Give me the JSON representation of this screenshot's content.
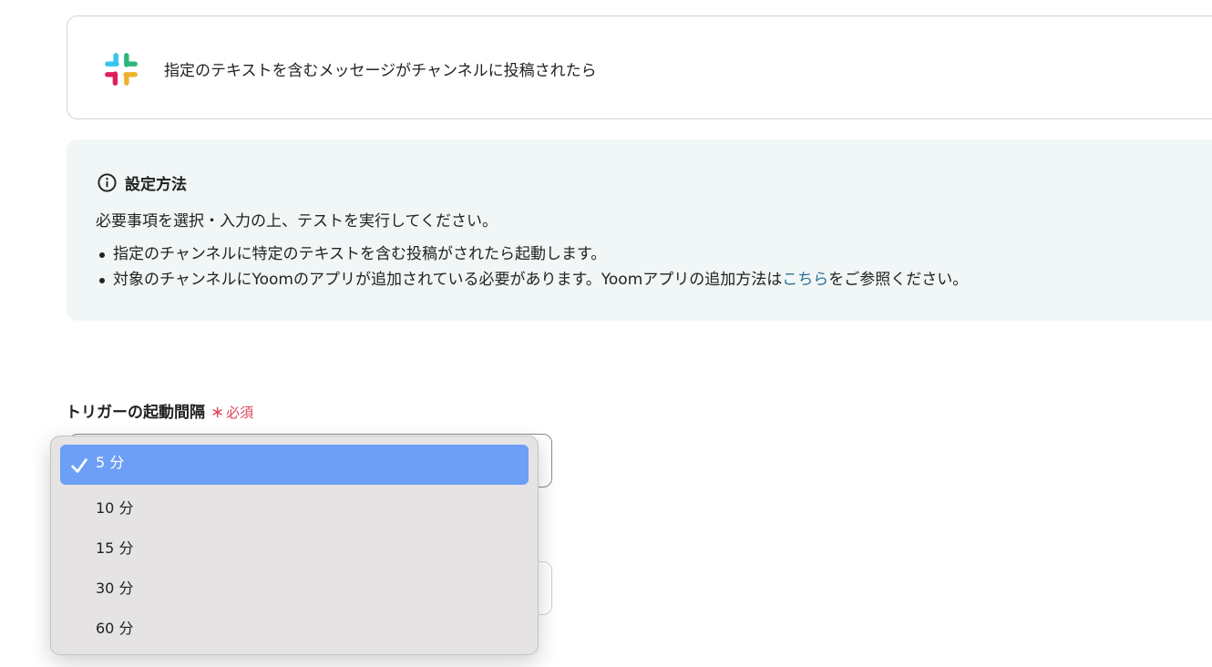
{
  "trigger": {
    "app_icon": "slack-logo",
    "title": "指定のテキストを含むメッセージがチャンネルに投稿されたら"
  },
  "info": {
    "icon": "info-icon",
    "heading": "設定方法",
    "description": "必要事項を選択・入力の上、テストを実行してください。",
    "bullets": [
      {
        "text": "指定のチャンネルに特定のテキストを含む投稿がされたら起動します。"
      },
      {
        "text_before": "対象のチャンネルにYoomのアプリが追加されている必要があります。Yoomアプリの追加方法は",
        "link_text": "こちら",
        "text_after": "をご参照ください。"
      }
    ],
    "link_color": "#2a6f97"
  },
  "field": {
    "label": "トリガーの起動間隔",
    "required_mark": "∗",
    "required_text": "必須",
    "required_color": "#e0475a"
  },
  "dropdown": {
    "selected_index": 0,
    "selected_color": "#6c9ff5",
    "options": [
      {
        "label": "5 分",
        "selected": true
      },
      {
        "label": "10 分",
        "selected": false
      },
      {
        "label": "15 分",
        "selected": false
      },
      {
        "label": "30 分",
        "selected": false
      },
      {
        "label": "60 分",
        "selected": false
      }
    ]
  }
}
